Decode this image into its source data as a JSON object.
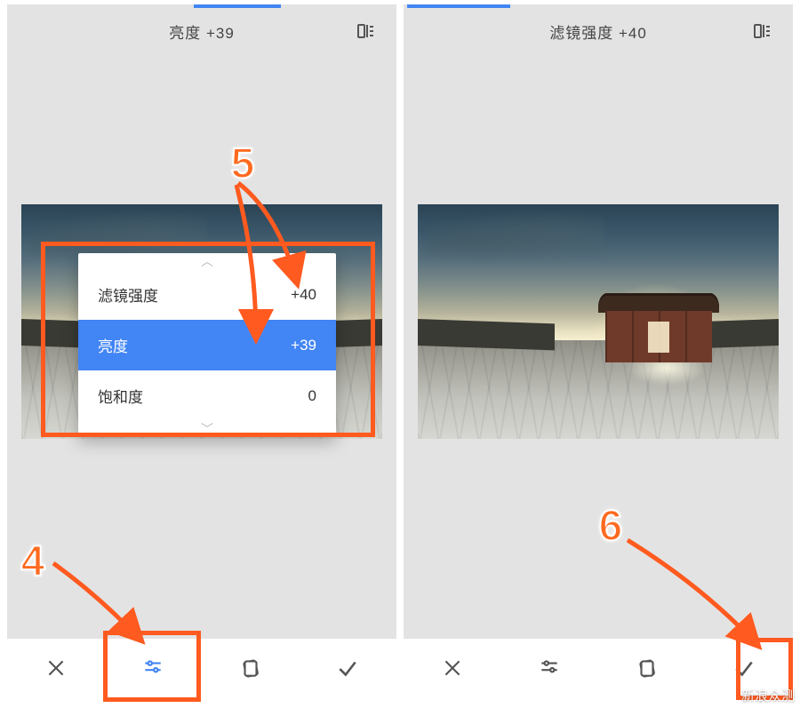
{
  "left": {
    "header_title": "亮度 +39",
    "menu": {
      "rows": [
        {
          "label": "滤镜强度",
          "value": "+40",
          "selected": false
        },
        {
          "label": "亮度",
          "value": "+39",
          "selected": true
        },
        {
          "label": "饱和度",
          "value": "0",
          "selected": false
        }
      ]
    }
  },
  "right": {
    "header_title": "滤镜强度 +40"
  },
  "toolbar_icons": {
    "cancel": "close-icon",
    "adjust": "sliders-icon",
    "styles": "card-icon",
    "apply": "check-icon"
  },
  "annotations": {
    "n4": "4",
    "n5": "5",
    "n6": "6"
  },
  "watermark": "新浪众测"
}
